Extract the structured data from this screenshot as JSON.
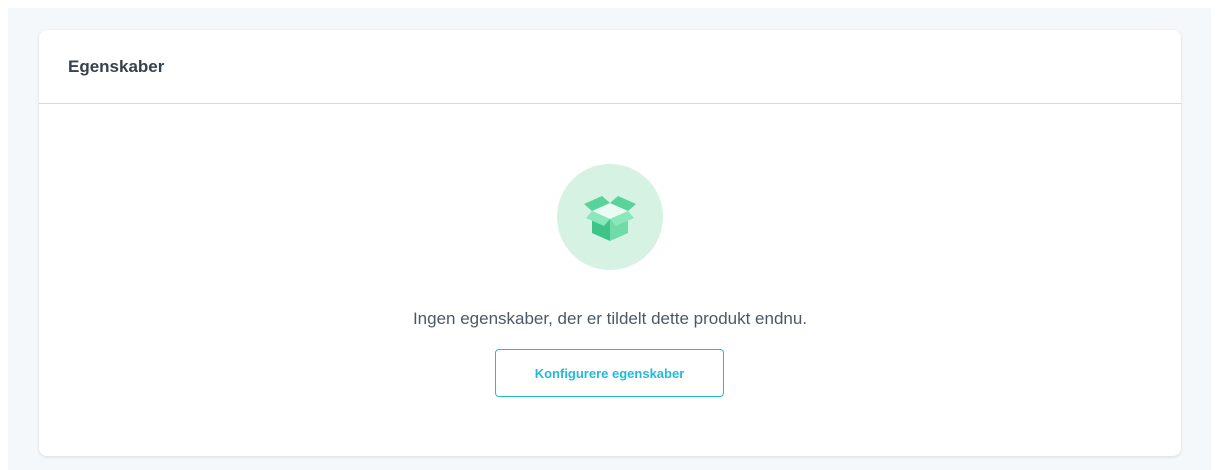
{
  "card": {
    "title": "Egenskaber"
  },
  "empty_state": {
    "icon": "open-box-icon",
    "message": "Ingen egenskaber, der er tildelt dette produkt endnu.",
    "button_label": "Konfigurere egenskaber"
  },
  "colors": {
    "accent": "#25b9d7",
    "icon_circle": "#d5f2e3",
    "icon_box": "#4bcf95",
    "title_text": "#37424d",
    "message_text": "#4b5967"
  }
}
